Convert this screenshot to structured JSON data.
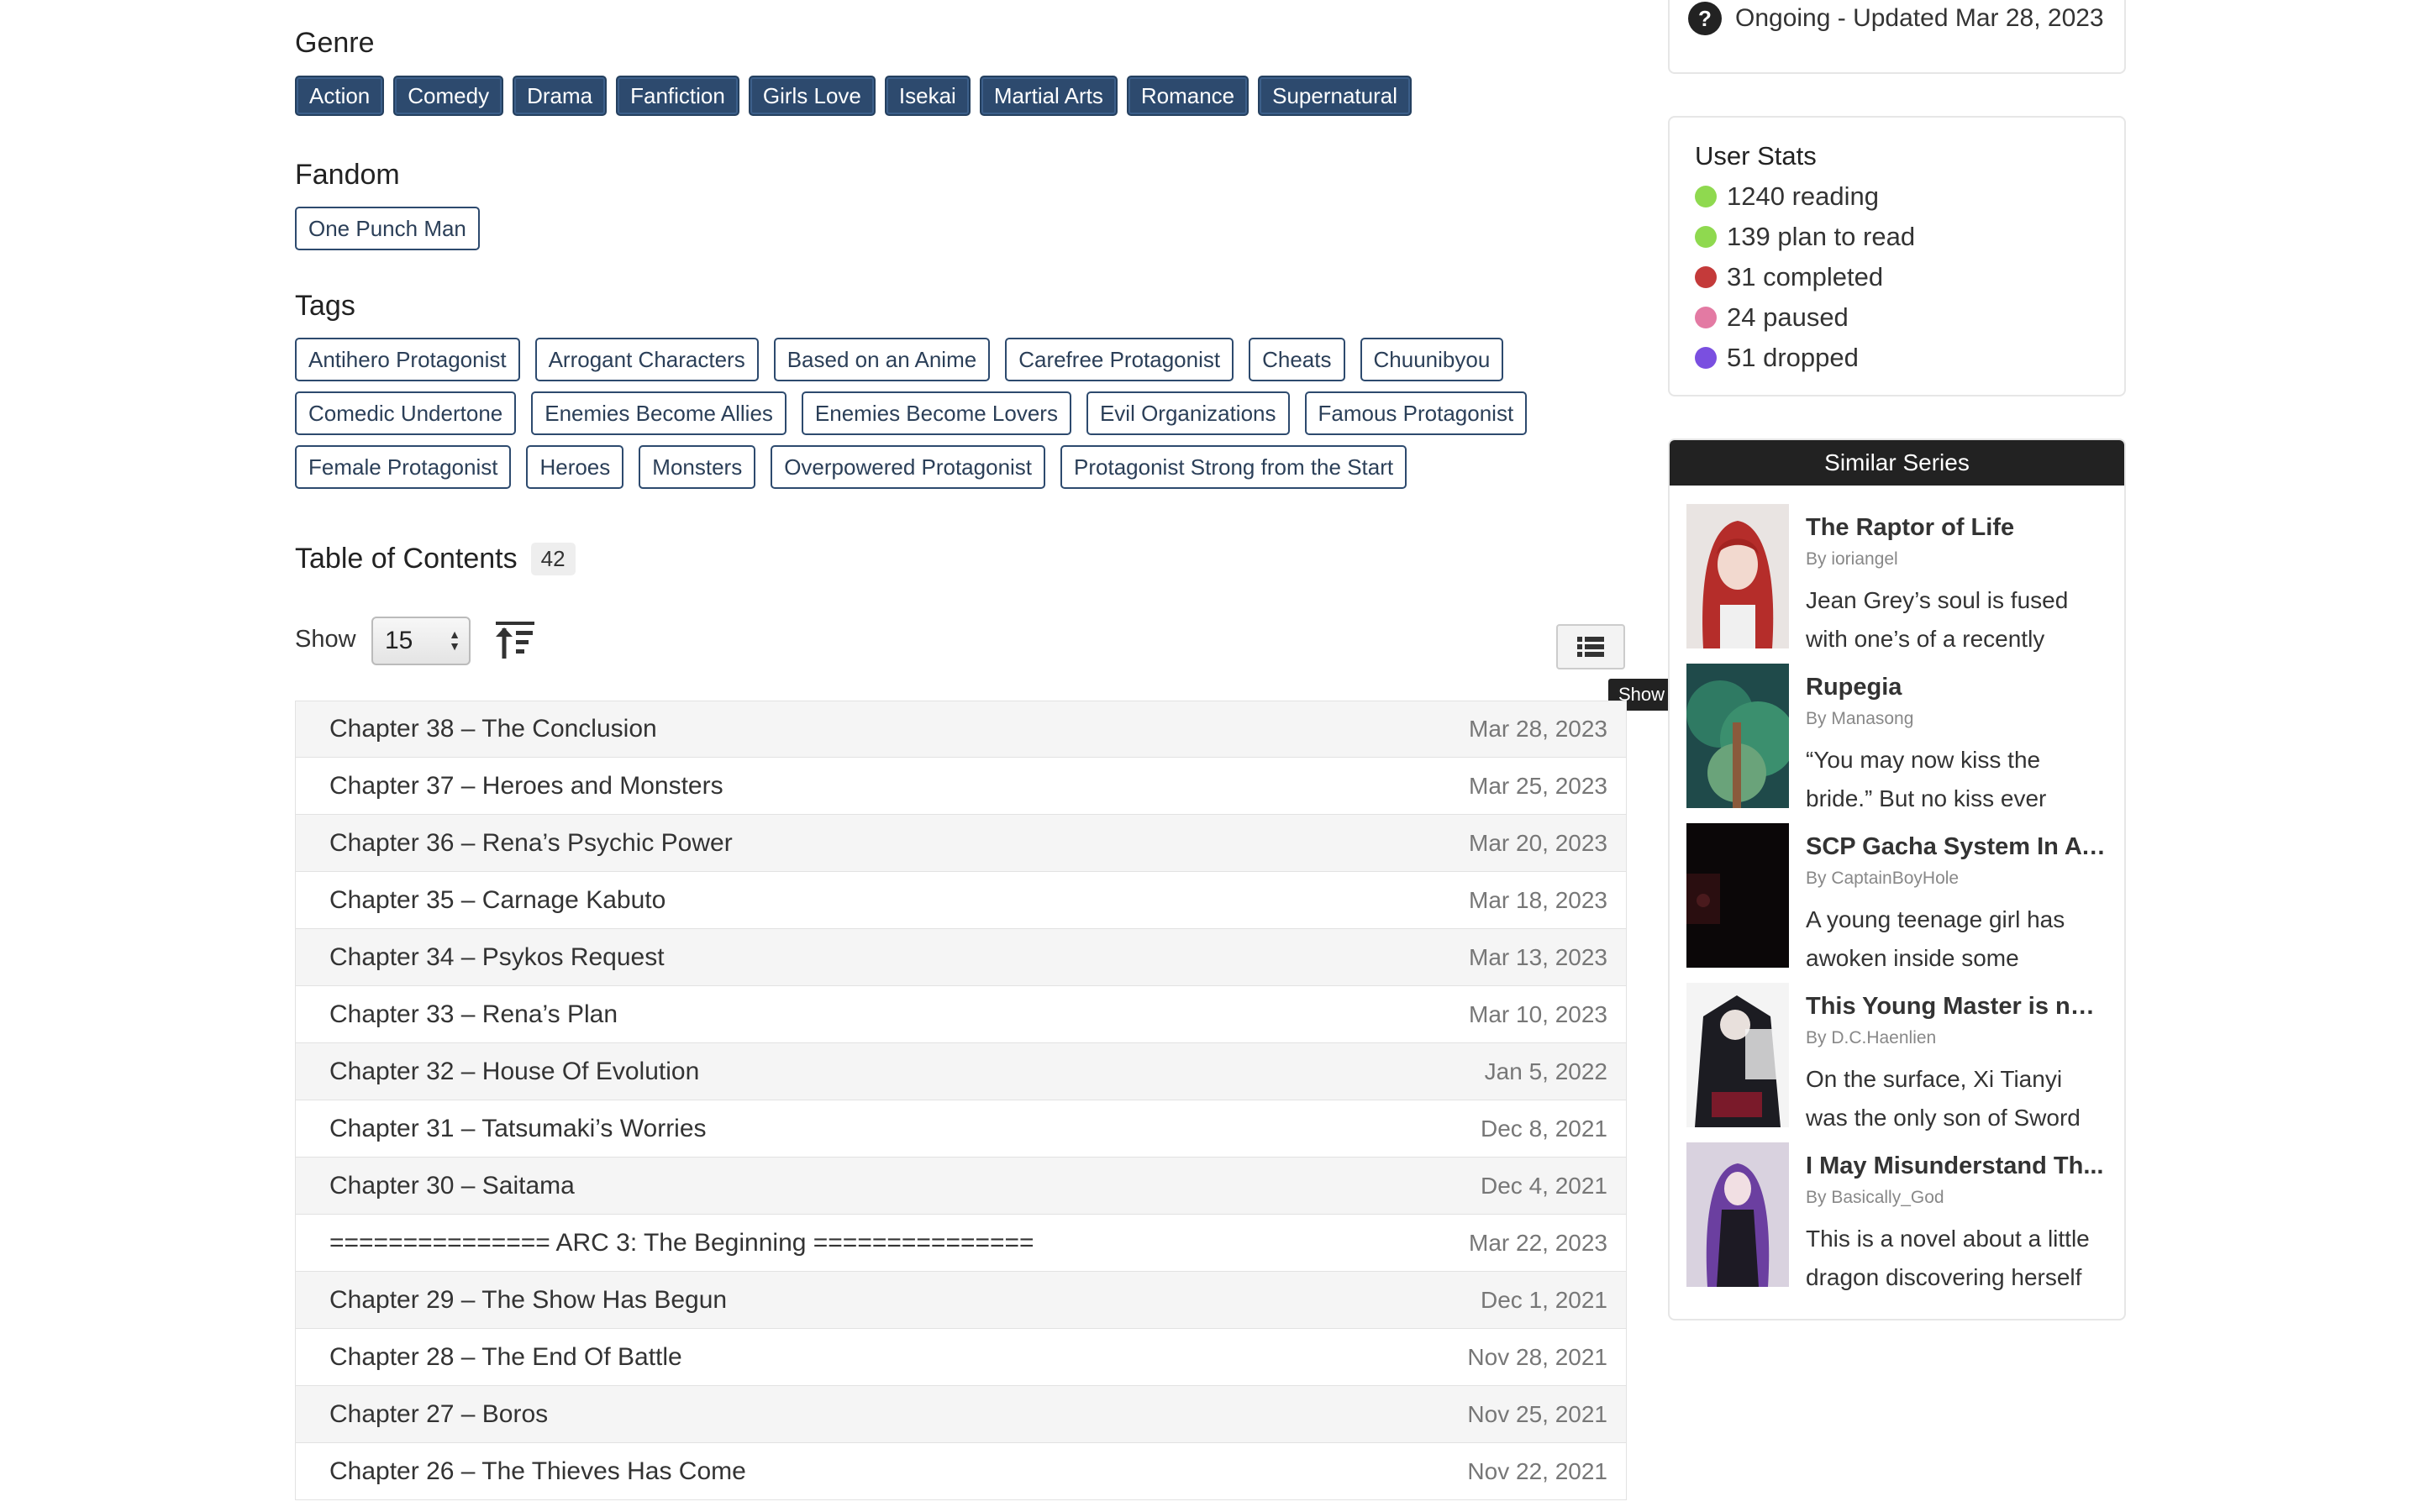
{
  "status": {
    "text": "Ongoing - Updated Mar 28, 2023",
    "icon": "question-circle-icon"
  },
  "genre": {
    "title": "Genre",
    "items": [
      "Action",
      "Comedy",
      "Drama",
      "Fanfiction",
      "Girls Love",
      "Isekai",
      "Martial Arts",
      "Romance",
      "Supernatural"
    ]
  },
  "fandom": {
    "title": "Fandom",
    "items": [
      "One Punch Man"
    ]
  },
  "tags": {
    "title": "Tags",
    "rows": [
      [
        "Antihero Protagonist",
        "Arrogant Characters",
        "Based on an Anime",
        "Carefree Protagonist",
        "Cheats",
        "Chuunibyou"
      ],
      [
        "Comedic Undertone",
        "Enemies Become Allies",
        "Enemies Become Lovers",
        "Evil Organizations",
        "Famous Protagonist"
      ],
      [
        "Female Protagonist",
        "Heroes",
        "Monsters",
        "Overpowered Protagonist",
        "Protagonist Strong from the Start"
      ]
    ]
  },
  "toc": {
    "title": "Table of Contents",
    "count": "42",
    "show_label": "Show",
    "show_value": "15",
    "tooltip": "Show All Chapters",
    "chapters": [
      {
        "title": "Chapter 38 – The Conclusion",
        "date": "Mar 28, 2023"
      },
      {
        "title": "Chapter 37 – Heroes and Monsters",
        "date": "Mar 25, 2023"
      },
      {
        "title": "Chapter 36 – Rena’s Psychic Power",
        "date": "Mar 20, 2023"
      },
      {
        "title": "Chapter 35 – Carnage Kabuto",
        "date": "Mar 18, 2023"
      },
      {
        "title": "Chapter 34 – Psykos Request",
        "date": "Mar 13, 2023"
      },
      {
        "title": "Chapter 33 – Rena’s Plan",
        "date": "Mar 10, 2023"
      },
      {
        "title": "Chapter 32 – House Of Evolution",
        "date": "Jan 5, 2022"
      },
      {
        "title": "Chapter 31 – Tatsumaki’s Worries",
        "date": "Dec 8, 2021"
      },
      {
        "title": "Chapter 30 – Saitama",
        "date": "Dec 4, 2021"
      },
      {
        "title": "=============== ARC 3: The Beginning ===============",
        "date": "Mar 22, 2023"
      },
      {
        "title": "Chapter 29 – The Show Has Begun",
        "date": "Dec 1, 2021"
      },
      {
        "title": "Chapter 28 – The End Of Battle",
        "date": "Nov 28, 2021"
      },
      {
        "title": "Chapter 27 – Boros",
        "date": "Nov 25, 2021"
      },
      {
        "title": "Chapter 26 – The Thieves Has Come",
        "date": "Nov 22, 2021"
      }
    ]
  },
  "user_stats": {
    "title": "User Stats",
    "items": [
      {
        "label": "1240 reading",
        "color": "#8fd94f"
      },
      {
        "label": "139 plan to read",
        "color": "#8fd94f"
      },
      {
        "label": "31 completed",
        "color": "#c43a3a"
      },
      {
        "label": "24 paused",
        "color": "#e37aa3"
      },
      {
        "label": "51 dropped",
        "color": "#7a4fe0"
      }
    ]
  },
  "similar": {
    "title": "Similar Series",
    "items": [
      {
        "title": "The Raptor of Life",
        "author": "By ioriangel",
        "desc": "Jean Grey’s soul is fused with one’s of a recently"
      },
      {
        "title": "Rupegia",
        "author": "By Manasong",
        "desc": "“You may now kiss the bride.” But no kiss ever"
      },
      {
        "title": "SCP Gacha System In A C...",
        "author": "By CaptainBoyHole",
        "desc": "A young teenage girl has awoken inside some"
      },
      {
        "title": "This Young Master is not...",
        "author": "By D.C.Haenlien",
        "desc": "On the surface, Xi Tianyi was the only son of Sword"
      },
      {
        "title": "I May Misunderstand Th...",
        "author": "By Basically_God",
        "desc": "This is a novel about a little dragon discovering herself"
      }
    ]
  }
}
